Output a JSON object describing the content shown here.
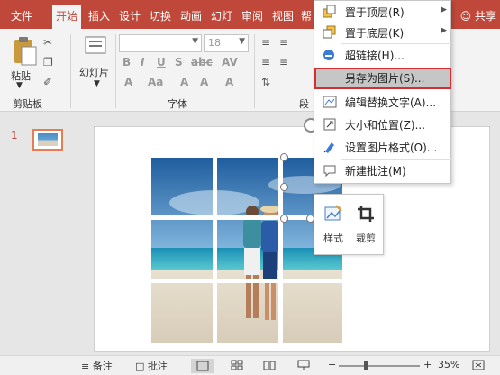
{
  "ribbon": {
    "tabs": [
      "文件",
      "开始",
      "插入",
      "设计",
      "切换",
      "动画",
      "幻灯",
      "审阅",
      "视图",
      "帮"
    ],
    "active_tab": 1,
    "share": "共享",
    "paste_label": "粘贴",
    "clipboard_group": "剪贴板",
    "slides_label": "幻灯片",
    "font_group": "字体",
    "paragraph_group": "段",
    "font_size": "18"
  },
  "context_menu": {
    "items": [
      {
        "label": "置于顶层(R)",
        "icon": "bring-to-front-icon",
        "submenu": true
      },
      {
        "label": "置于底层(K)",
        "icon": "send-to-back-icon",
        "submenu": true
      },
      {
        "label": "超链接(H)...",
        "icon": "hyperlink-icon",
        "submenu": false
      },
      {
        "label": "另存为图片(S)...",
        "icon": "",
        "submenu": false,
        "highlighted": true
      },
      {
        "label": "编辑替换文字(A)...",
        "icon": "alt-text-icon",
        "submenu": false
      },
      {
        "label": "大小和位置(Z)...",
        "icon": "size-position-icon",
        "submenu": false
      },
      {
        "label": "设置图片格式(O)...",
        "icon": "format-picture-icon",
        "submenu": false
      },
      {
        "label": "新建批注(M)",
        "icon": "new-comment-icon",
        "submenu": false
      }
    ]
  },
  "mini_toolbar": {
    "style_label": "样式",
    "crop_label": "裁剪"
  },
  "thumbnails": {
    "slide_number": "1"
  },
  "statusbar": {
    "notes_label": "备注",
    "comments_label": "批注",
    "zoom": "35%"
  },
  "colors": {
    "accent": "#c0483a",
    "highlight_border": "#d62e2e"
  }
}
